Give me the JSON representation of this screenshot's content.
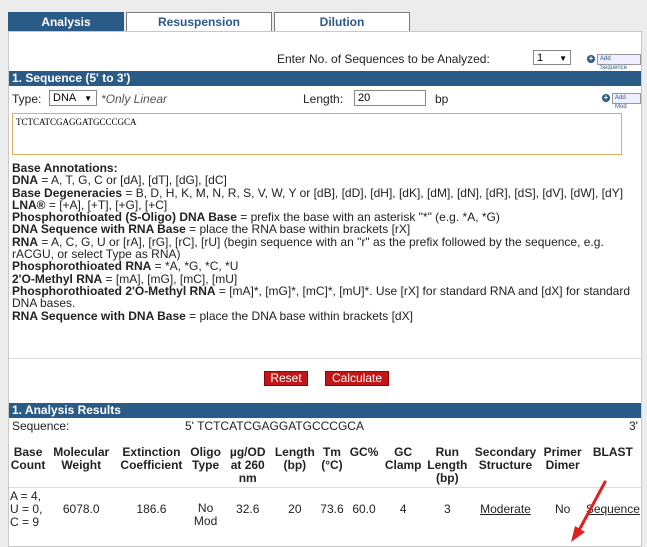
{
  "tabs": {
    "analysis": "Analysis",
    "resuspension": "Resuspension",
    "dilution": "Dilution"
  },
  "top": {
    "enter_label": "Enter No. of Sequences to be Analyzed:",
    "num_sequences": "1",
    "add_sequence": "Add Sequence"
  },
  "sequence_section": {
    "title": "1. Sequence (5' to 3')",
    "type_label": "Type:",
    "type_value": "DNA",
    "only_linear": "*Only Linear",
    "length_label": "Length:",
    "length_value": "20",
    "bp": "bp",
    "add_mod": "Add Mod",
    "sequence": "TCTCATCGAGGATGCCCGCA"
  },
  "annotations": {
    "heading": "Base Annotations:",
    "dna_k": "DNA",
    "dna_v": " = A, T, G, C or [dA], [dT], [dG], [dC]",
    "deg_k": "Base Degeneracies",
    "deg_v": " = B, D, H, K, M, N, R, S, V, W, Y or [dB], [dD], [dH], [dK], [dM], [dN], [dR], [dS], [dV], [dW], [dY]",
    "lna_k": "LNA®",
    "lna_v": " = [+A], [+T], [+G], [+C]",
    "so_k": "Phosphorothioated (S-Oligo) DNA Base",
    "so_v": " = prefix the base with an asterisk \"*\" (e.g. *A, *G)",
    "dnarna_k": "DNA Sequence with RNA Base",
    "dnarna_v": " = place the RNA base within brackets [rX]",
    "rna_k": "RNA",
    "rna_v": " = A, C, G, U or [rA], [rG], [rC], [rU] (begin sequence with an \"r\" as the prefix followed by the sequence, e.g. rACGU, or select Type as RNA)",
    "prna_k": "Phosphorothioated RNA",
    "prna_v": " = *A, *G, *C, *U",
    "ome_k": "2'O-Methyl RNA",
    "ome_v": " = [mA], [mG], [mC], [mU]",
    "pome_k": "Phosphorothioated 2'O-Methyl RNA",
    "pome_v": " = [mA]*, [mG]*, [mC]*, [mU]*. Use [rX] for standard RNA and [dX] for standard DNA bases.",
    "rnadna_k": "RNA Sequence with DNA Base",
    "rnadna_v": " = place the DNA base within brackets [dX]"
  },
  "buttons": {
    "reset": "Reset",
    "calculate": "Calculate"
  },
  "results": {
    "title": "1. Analysis Results",
    "sequence_label": "Sequence:",
    "sequence_value": "5' TCTCATCGAGGATGCCCGCA",
    "sequence_end": "3'",
    "headers": [
      "Base Count",
      "Molecular Weight",
      "Extinction Coefficient",
      "Oligo Type",
      "µg/OD at 260 nm",
      "Length (bp)",
      "Tm (°C)",
      "GC%",
      "GC Clamp",
      "Run Length (bp)",
      "Secondary Structure",
      "Primer Dimer",
      "BLAST"
    ],
    "row": [
      "A = 4, U = 0, C = 9",
      "6078.0",
      "186.6",
      "No Mod",
      "32.6",
      "20",
      "73.6",
      "60.0",
      "4",
      "3",
      "Moderate",
      "No",
      "Sequence"
    ]
  },
  "colors": {
    "header_blue": "#2a5a86",
    "button_red": "#c01818",
    "arrow_red": "#e02020"
  }
}
